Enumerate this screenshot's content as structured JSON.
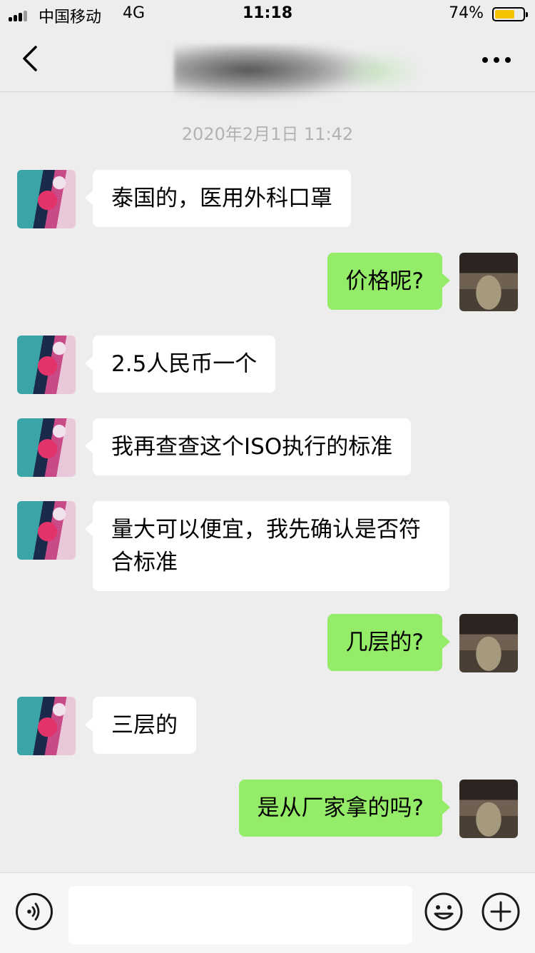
{
  "status_bar": {
    "carrier": "中国移动",
    "network": "4G",
    "time": "11:18",
    "battery_percent": "74%",
    "battery_level": 0.74,
    "battery_color": "#f5c400"
  },
  "nav": {
    "back_icon": "chevron-left-icon",
    "more_icon": "more-horizontal-icon"
  },
  "chat": {
    "timestamp": "2020年2月1日 11:42",
    "messages": [
      {
        "from": "other",
        "text": "泰国的，医用外科口罩"
      },
      {
        "from": "self",
        "text": "价格呢?"
      },
      {
        "from": "other",
        "text": "2.5人民币一个"
      },
      {
        "from": "other",
        "text": "我再查查这个ISO执行的标准"
      },
      {
        "from": "other",
        "text": "量大可以便宜，我先确认是否符合标准"
      },
      {
        "from": "self",
        "text": "几层的?"
      },
      {
        "from": "other",
        "text": "三层的"
      },
      {
        "from": "self",
        "text": "是从厂家拿的吗?"
      }
    ]
  },
  "input_bar": {
    "voice_icon": "voice-icon",
    "text_value": "",
    "emoji_icon": "emoji-icon",
    "plus_icon": "plus-icon"
  },
  "colors": {
    "background": "#ededed",
    "incoming_bubble": "#ffffff",
    "outgoing_bubble": "#95ec69",
    "timestamp": "#b2b2b2"
  }
}
